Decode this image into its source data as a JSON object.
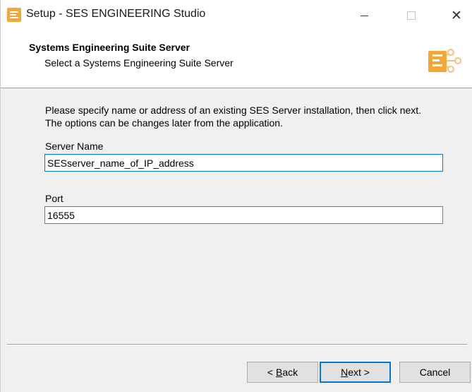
{
  "window": {
    "title": "Setup - SES ENGINEERING Studio",
    "minimize_symbol": "—",
    "close_symbol": "✕"
  },
  "header": {
    "title": "Systems Engineering Suite Server",
    "subtitle": "Select a Systems Engineering Suite Server",
    "logo_icon": "ses-logo-icon",
    "logo_color": "#f2a838"
  },
  "body": {
    "description": "Please specify name or address of an existing SES Server installation, then click next. The options can be changes later from the application.",
    "server_name": {
      "label": "Server Name",
      "value": "SESserver_name_of_IP_address"
    },
    "port": {
      "label": "Port",
      "value": "16555"
    }
  },
  "footer": {
    "back": {
      "prefix": "< ",
      "accel": "B",
      "rest": "ack"
    },
    "next": {
      "accel": "N",
      "rest": "ext >"
    },
    "cancel": "Cancel"
  },
  "colors": {
    "accent": "#0078d7",
    "window_bg": "#f0f0f0",
    "header_bg": "#ffffff"
  }
}
